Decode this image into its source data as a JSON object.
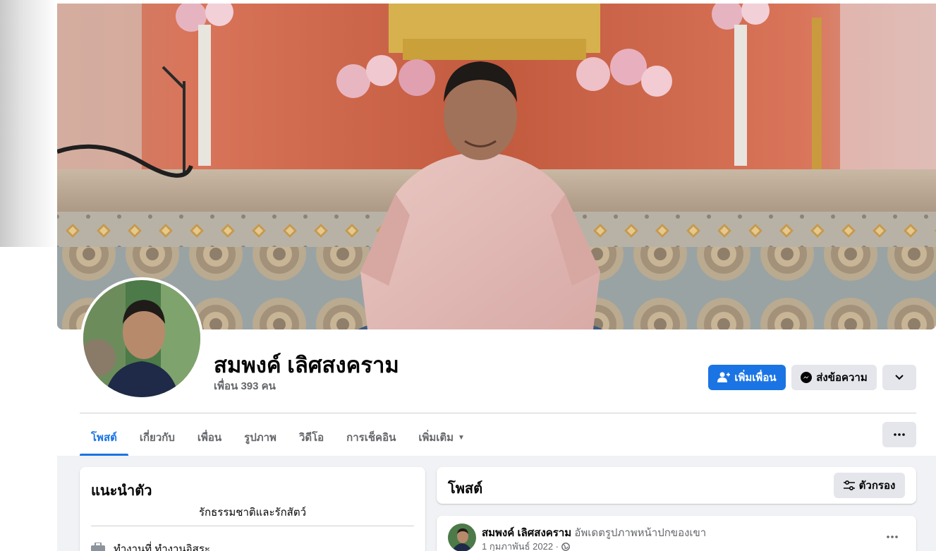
{
  "profile": {
    "name": "สมพงค์ เลิศสงคราม",
    "friends_count": "เพื่อน 393 คน"
  },
  "actions": {
    "add_friend": "เพิ่มเพื่อน",
    "message": "ส่งข้อความ"
  },
  "tabs": [
    {
      "label": "โพสต์",
      "active": true
    },
    {
      "label": "เกี่ยวกับ"
    },
    {
      "label": "เพื่อน"
    },
    {
      "label": "รูปภาพ"
    },
    {
      "label": "วิดีโอ"
    },
    {
      "label": "การเช็คอิน"
    },
    {
      "label": "เพิ่มเติม"
    }
  ],
  "intro": {
    "title": "แนะนำตัว",
    "bio": "รักธรรมชาติและรักสัตว์",
    "work": "ทำงานที่ ทำงานอิสระ"
  },
  "posts": {
    "title": "โพสต์",
    "filter_label": "ตัวกรอง"
  },
  "post": {
    "author": "สมพงค์ เลิศสงคราม",
    "action": "อัพเดตรูปภาพหน้าปกของเขา",
    "date": "1 กุมภาพันธ์ 2022 ·"
  },
  "colors": {
    "accent": "#1b74e4",
    "secondary_button": "#e4e6eb",
    "page_background": "#f0f2f5"
  }
}
